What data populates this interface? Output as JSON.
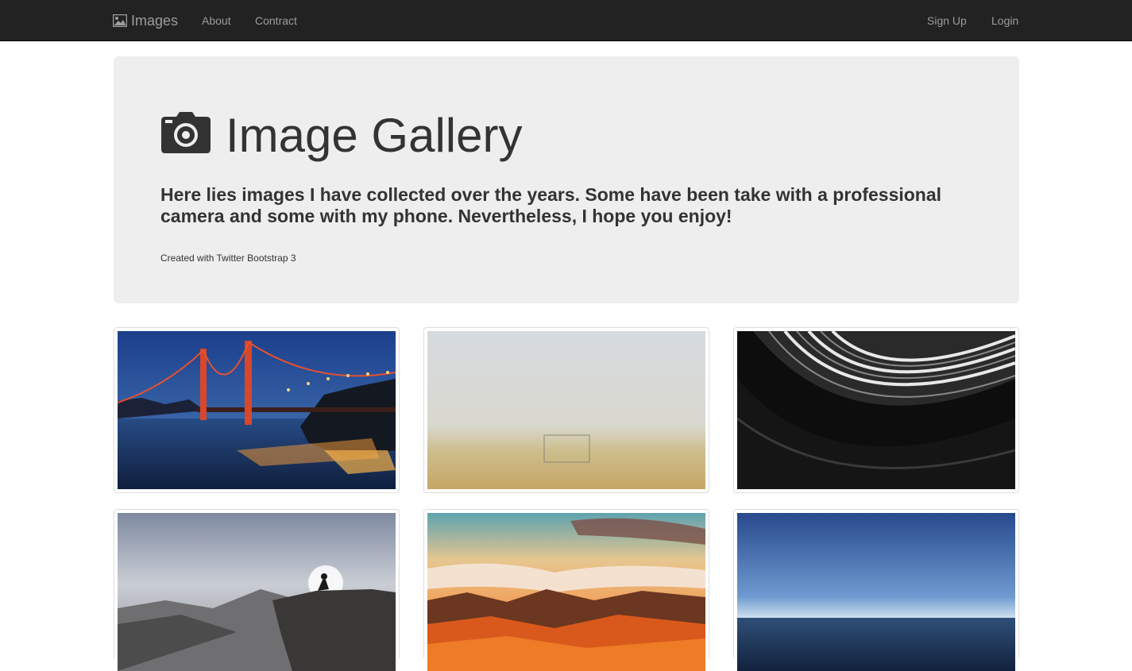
{
  "navbar": {
    "brand_label": "Images",
    "brand_icon": "picture-icon",
    "left_links": [
      "About",
      "Contract"
    ],
    "right_links": [
      "Sign Up",
      "Login"
    ],
    "background": "#222222",
    "link_color": "#9d9d9d"
  },
  "jumbotron": {
    "title": "Image Gallery",
    "title_icon": "camera-icon",
    "lead": "Here lies images I have collected over the years. Some have been take with a professional camera and some with my phone. Nevertheless, I hope you enjoy!",
    "credit": "Created with Twitter Bootstrap 3",
    "background": "#eeeeee"
  },
  "gallery": {
    "images": [
      {
        "subject": "golden-gate-bridge-at-dusk"
      },
      {
        "subject": "foggy-soccer-field"
      },
      {
        "subject": "abstract-black-white-architecture"
      },
      {
        "subject": "person-sitting-on-cliff-edge"
      },
      {
        "subject": "sunset-mountains-above-clouds"
      },
      {
        "subject": "blue-sky-over-ocean-horizon"
      }
    ]
  }
}
